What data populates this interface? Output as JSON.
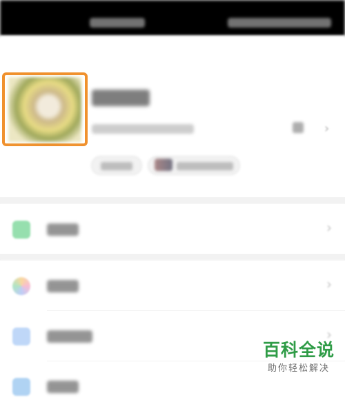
{
  "watermark": {
    "title": "百科全说",
    "subtitle": "助你轻松解决"
  },
  "colors": {
    "highlight": "#f0912d",
    "watermark_green": "#2f9c47",
    "status_bar": "#000000",
    "section_gap": "#f2f2f2"
  },
  "menu": {
    "items": [
      {
        "icon": "chat-bubble-icon",
        "color": "#3fc46b"
      },
      {
        "icon": "pinwheel-icon",
        "color": "#f2a7c8"
      },
      {
        "icon": "folder-icon",
        "color": "#7fb0f2"
      },
      {
        "icon": "card-icon",
        "color": "#61a8e8"
      }
    ]
  }
}
